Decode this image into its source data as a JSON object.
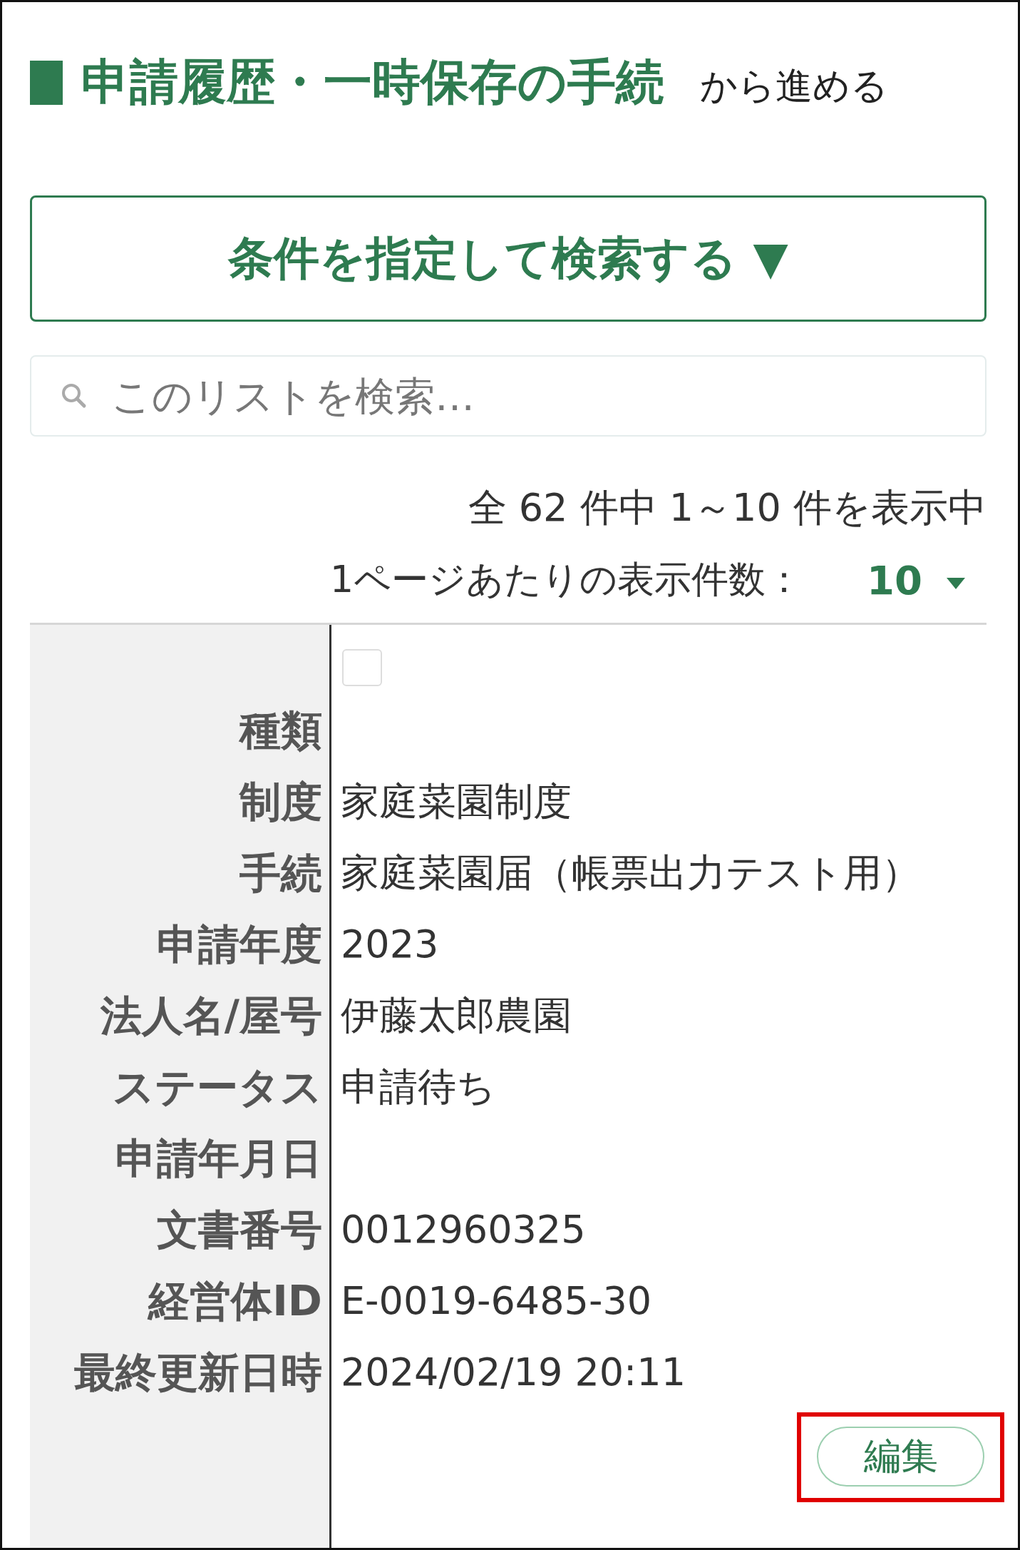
{
  "heading": {
    "title": "申請履歴・一時保存の手続",
    "suffix": "から進める"
  },
  "search_toggle": {
    "label": "条件を指定して検索する ▼"
  },
  "search": {
    "placeholder": "このリストを検索…"
  },
  "result_count": "全 62 件中 1～10 件を表示中",
  "per_page": {
    "label": "1ページあたりの表示件数：",
    "value": "10"
  },
  "record": {
    "checked": false,
    "fields": [
      {
        "label": "種類"
      },
      {
        "label": "制度",
        "value": "家庭菜園制度"
      },
      {
        "label": "手続",
        "value": "家庭菜園届（帳票出力テスト用）"
      },
      {
        "label": "申請年度",
        "value": "2023"
      },
      {
        "label": "法人名/屋号",
        "value": "伊藤太郎農園"
      },
      {
        "label": "ステータス",
        "value": "申請待ち"
      },
      {
        "label": "申請年月日"
      },
      {
        "label": "文書番号",
        "value": "0012960325"
      },
      {
        "label": "経営体ID",
        "value": "E-0019-6485-30"
      },
      {
        "label": "最終更新日時",
        "value": "2024/02/19 20:11"
      }
    ]
  },
  "edit_button": {
    "label": "編集",
    "highlighted": true
  }
}
